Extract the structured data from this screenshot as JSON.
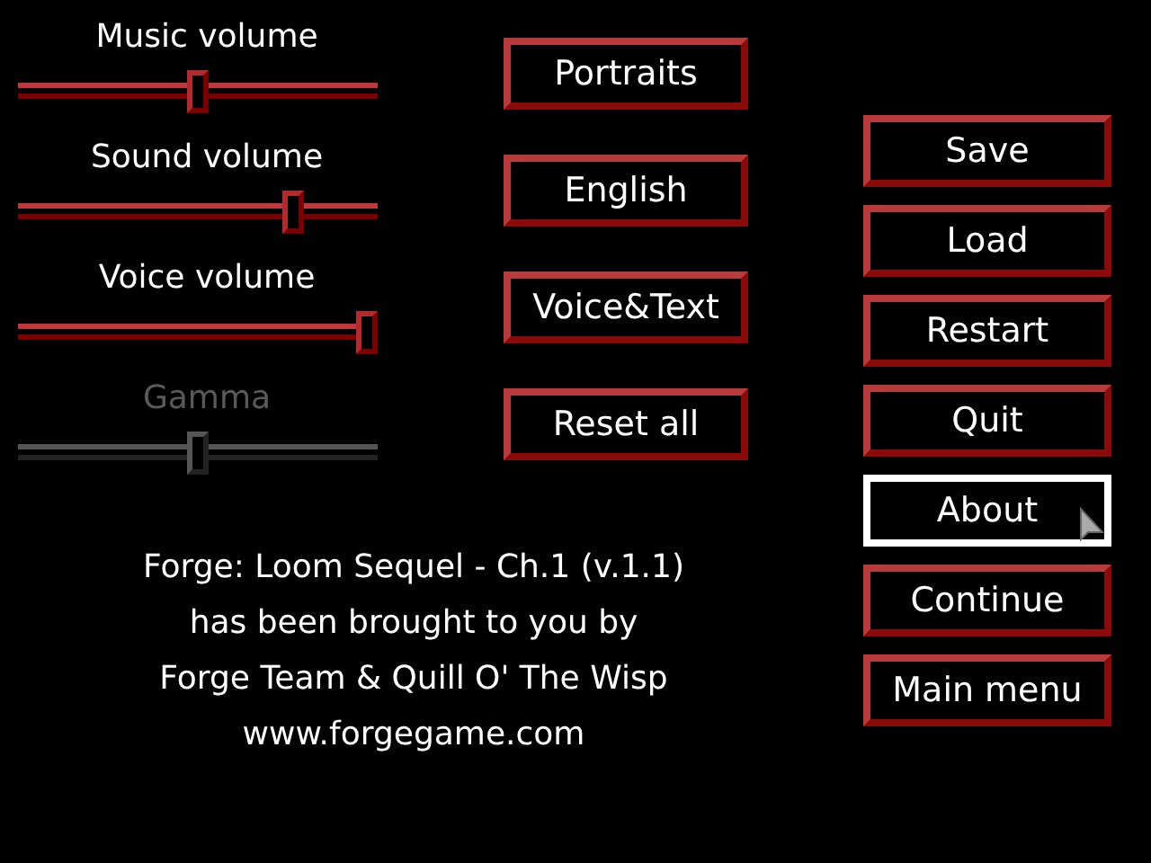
{
  "sliders": [
    {
      "label": "Music volume",
      "level": 0.5,
      "disabled": false
    },
    {
      "label": "Sound volume",
      "level": 0.78,
      "disabled": false
    },
    {
      "label": "Voice volume",
      "level": 1.0,
      "disabled": false
    },
    {
      "label": "Gamma",
      "level": 0.5,
      "disabled": true
    }
  ],
  "option_buttons": [
    {
      "label": "Portraits"
    },
    {
      "label": "English"
    },
    {
      "label": "Voice&Text"
    },
    {
      "label": "Reset all"
    }
  ],
  "about_lines": [
    "Forge: Loom Sequel - Ch.1 (v.1.1)",
    "has been brought to you by",
    "Forge Team & Quill O' The Wisp",
    "www.forgegame.com"
  ],
  "menu_buttons": [
    {
      "label": "Save",
      "selected": false
    },
    {
      "label": "Load",
      "selected": false
    },
    {
      "label": "Restart",
      "selected": false
    },
    {
      "label": "Quit",
      "selected": false
    },
    {
      "label": "About",
      "selected": true
    },
    {
      "label": "Continue",
      "selected": false
    },
    {
      "label": "Main menu",
      "selected": false
    }
  ]
}
